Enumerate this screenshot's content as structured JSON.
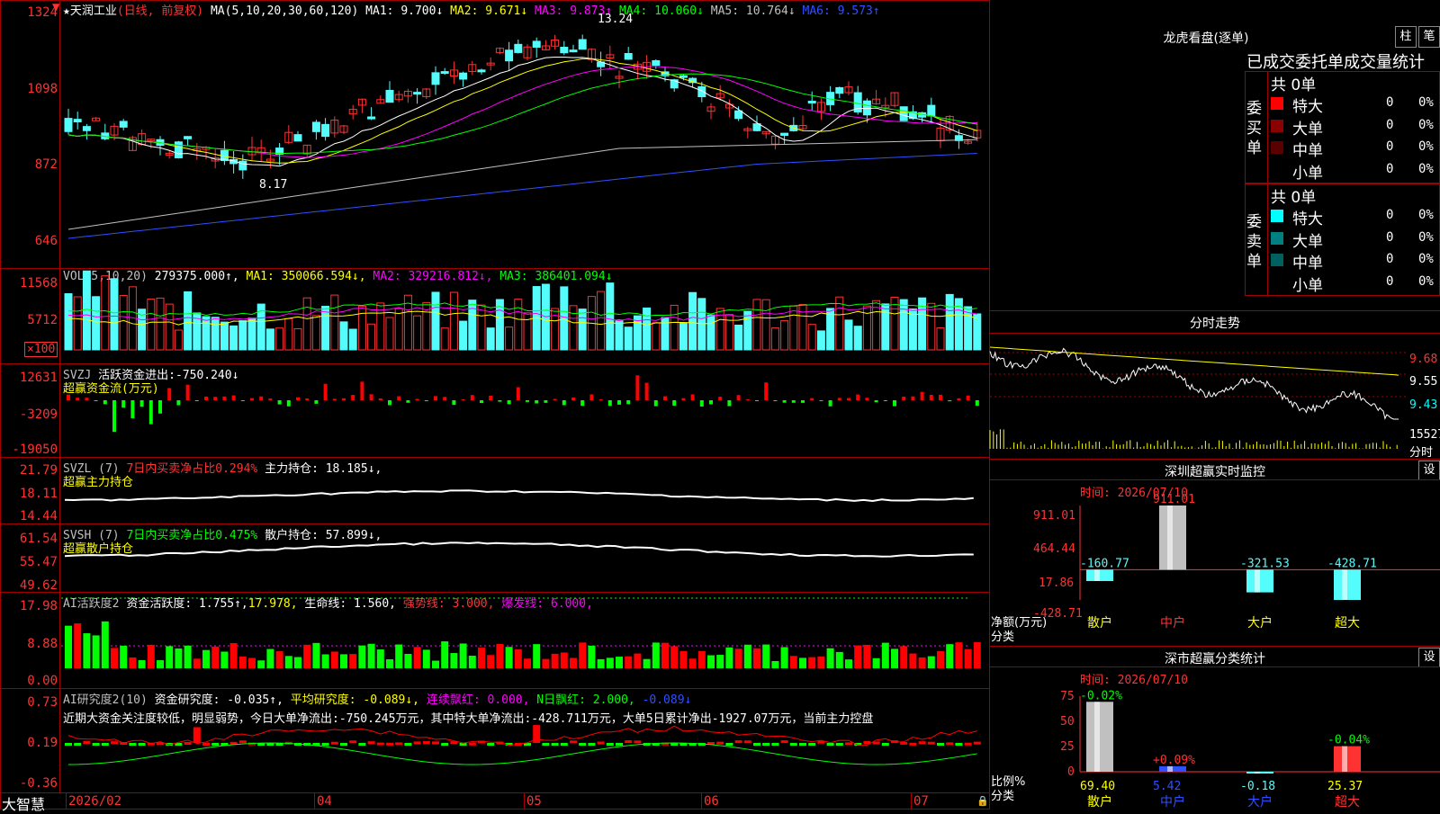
{
  "stock": {
    "name": "★天润工业",
    "mode": "(日线, 前复权)",
    "ma_header": "MA(5,10,20,30,60,120)",
    "ma": [
      {
        "label": "MA1:",
        "value": "9.700↓",
        "color": "#ffffff"
      },
      {
        "label": "MA2:",
        "value": "9.671↓",
        "color": "#ffff00"
      },
      {
        "label": "MA3:",
        "value": "9.873↑",
        "color": "#ff00ff"
      },
      {
        "label": "MA4:",
        "value": "10.060↓",
        "color": "#00ff00"
      },
      {
        "label": "MA5:",
        "value": "10.764↓",
        "color": "#c0c0c0"
      },
      {
        "label": "MA6:",
        "value": "9.573↑",
        "color": "#3050ff"
      }
    ],
    "high_mark": "13.24",
    "low_mark": "8.17"
  },
  "price_axis": [
    "1324",
    "1098",
    "872",
    "646"
  ],
  "vol": {
    "header": "VOL(5,10,20)",
    "value": "279375.000↑,",
    "ma": [
      {
        "label": "MA1:",
        "value": "350066.594↓,",
        "color": "#ffff00"
      },
      {
        "label": "MA2:",
        "value": "329216.812↓,",
        "color": "#ff00ff"
      },
      {
        "label": "MA3:",
        "value": "386401.094↓",
        "color": "#00ff00"
      }
    ],
    "axis": [
      "11568",
      "5712"
    ],
    "unit": "×100"
  },
  "svzj": {
    "header": "SVZJ",
    "text": "活跃资金进出:",
    "value": "-750.240↓",
    "subtitle": "超赢资金流(万元)",
    "axis": [
      "12631",
      "-3209",
      "-19050"
    ]
  },
  "svzl": {
    "header": "SVZL (7)",
    "note": "7日内买卖净占比0.294%",
    "label": "主力持仓:",
    "value": "18.185↓,",
    "subtitle": "超赢主力持仓",
    "axis": [
      "21.79",
      "18.11",
      "14.44"
    ]
  },
  "svsh": {
    "header": "SVSH (7)",
    "note": "7日内买卖净占比0.475%",
    "label": "散户持仓:",
    "value": "57.899↓,",
    "subtitle": "超赢散户持仓",
    "axis": [
      "61.54",
      "55.47",
      "49.62"
    ]
  },
  "ai1": {
    "header": "AI活跃度2",
    "l1": "资金活跃度:",
    "v1": "1.755↑,",
    "v2": "17.978,",
    "l3": "生命线:",
    "v3": "1.560,",
    "l4": "强势线:",
    "v4": "3.000,",
    "l5": "爆发线:",
    "v5": "6.000,",
    "axis": [
      "17.98",
      "8.88",
      "0.00"
    ]
  },
  "ai2": {
    "header": "AI研究度2(10)",
    "l1": "资金研究度:",
    "v1": "-0.035↑,",
    "l2": "平均研究度:",
    "v2": "-0.089↓,",
    "l3": "连续飘红:",
    "v3": "0.000,",
    "l4": "N日飘红:",
    "v4": "2.000,",
    "v5": "-0.089↓",
    "comment": "近期大资金关注度较低，明显弱势，今日大单净流出:-750.245万元，其中特大单净流出:-428.711万元，大单5日累计净出-1927.07万元，当前主力控盘",
    "axis": [
      "0.73",
      "0.19",
      "-0.36"
    ]
  },
  "bottom": {
    "brand": "大智慧",
    "dates": [
      "2026/02",
      "04",
      "05",
      "06",
      "07"
    ]
  },
  "right": {
    "lhkp_title": "龙虎看盘(逐单)",
    "btn_zhu": "柱",
    "btn_bi": "笔",
    "tabs": "已成交委托单成交量统计",
    "buy": {
      "label": "委买单",
      "total": "共 0单",
      "rows": [
        {
          "name": "特大",
          "count": "0",
          "pct": "0%",
          "color": "#ff0000"
        },
        {
          "name": "大单",
          "count": "0",
          "pct": "0%",
          "color": "#8b0000"
        },
        {
          "name": "中单",
          "count": "0",
          "pct": "0%",
          "color": "#5a0000"
        },
        {
          "name": "小单",
          "count": "0",
          "pct": "0%",
          "color": "#000000"
        }
      ]
    },
    "sell": {
      "label": "委卖单",
      "total": "共 0单",
      "rows": [
        {
          "name": "特大",
          "count": "0",
          "pct": "0%",
          "color": "#00ffff"
        },
        {
          "name": "大单",
          "count": "0",
          "pct": "0%",
          "color": "#008080"
        },
        {
          "name": "中单",
          "count": "0",
          "pct": "0%",
          "color": "#006060"
        },
        {
          "name": "小单",
          "count": "0",
          "pct": "0%",
          "color": "#000000"
        }
      ]
    },
    "fenshi": {
      "title": "分时走势",
      "axis": [
        "9.68",
        "9.55",
        "9.43"
      ],
      "vol": "15527",
      "unit": "分时"
    },
    "monitor": {
      "title": "深圳超赢实时监控",
      "btn": "设",
      "time": "时间: 2026/07/10",
      "axis": [
        "911.01",
        "464.44",
        "17.86",
        "-428.71"
      ],
      "ylabel": "净额(万元)",
      "xlabel": "分类",
      "categories": [
        "散户",
        "中户",
        "大户",
        "超大"
      ],
      "values_text": [
        "-160.77",
        "911.01",
        "-321.53",
        "-428.71"
      ]
    },
    "classify": {
      "title": "深市超赢分类统计",
      "btn": "设",
      "time": "时间: 2026/07/10",
      "axis": [
        "75",
        "50",
        "25",
        "0"
      ],
      "ylabel": "比例%",
      "xlabel": "分类",
      "categories": [
        "散户",
        "中户",
        "大户",
        "超大"
      ],
      "top_text": [
        "-0.02%",
        "+0.09%",
        "",
        "-0.04%"
      ],
      "bottom_text": [
        "69.40",
        "5.42",
        "-0.18",
        "25.37"
      ]
    }
  },
  "chart_data": [
    {
      "type": "bar",
      "title": "深圳超赢实时监控",
      "categories": [
        "散户",
        "中户",
        "大户",
        "超大"
      ],
      "values": [
        -160.77,
        911.01,
        -321.53,
        -428.71
      ],
      "ylabel": "净额(万元)",
      "ylim": [
        -428.71,
        911.01
      ]
    },
    {
      "type": "bar",
      "title": "深市超赢分类统计",
      "categories": [
        "散户",
        "中户",
        "大户",
        "超大"
      ],
      "values": [
        69.4,
        5.42,
        -0.18,
        25.37
      ],
      "ylabel": "比例%",
      "ylim": [
        0,
        75
      ]
    }
  ]
}
